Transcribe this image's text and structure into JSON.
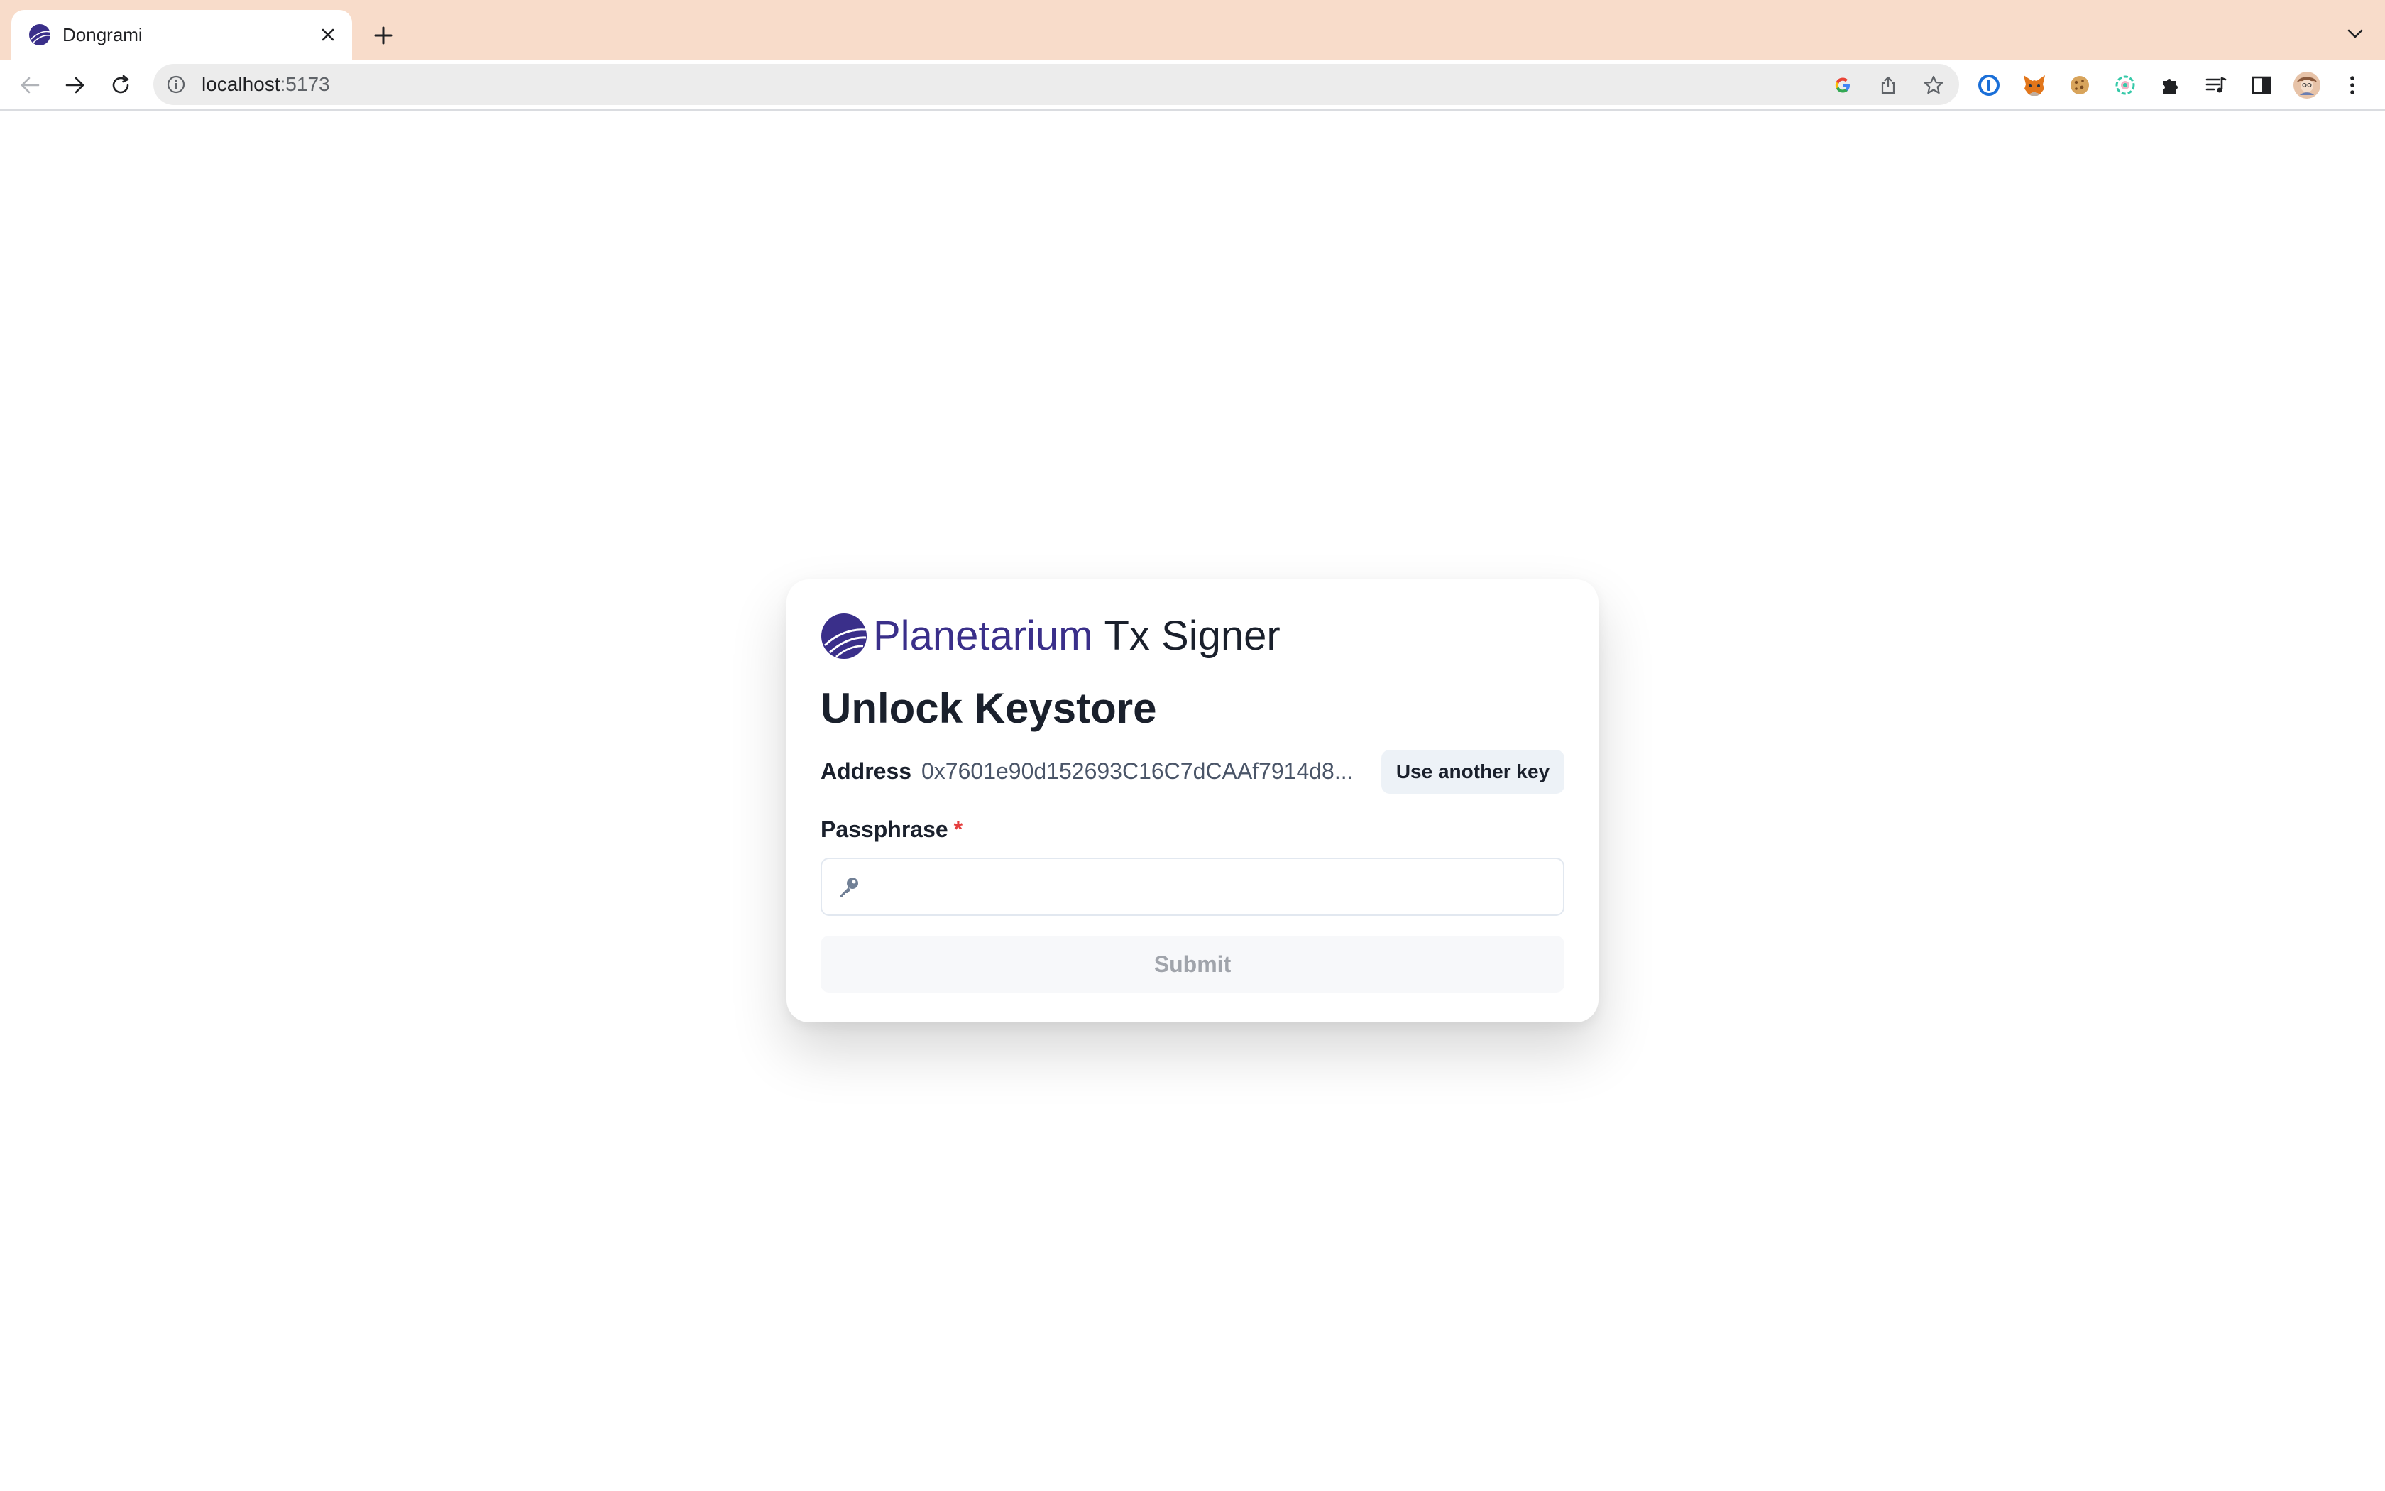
{
  "browser": {
    "tab": {
      "title": "Dongrami",
      "favicon": "planetarium-logo-icon"
    },
    "omnibox": {
      "host": "localhost",
      "port": ":5173"
    },
    "extensions": [
      "onepassword-icon",
      "metamask-fox-icon",
      "cookie-icon",
      "colorful-circle-icon",
      "puzzle-extensions-icon",
      "reading-list-icon",
      "side-panel-icon",
      "profile-avatar",
      "kebab-menu-icon"
    ]
  },
  "page": {
    "brand": {
      "name": "Planetarium",
      "suffix": "Tx Signer"
    },
    "heading": "Unlock Keystore",
    "address": {
      "label": "Address",
      "value": "0x7601e90d152693C16C7dCAAf7914d8..."
    },
    "another_key_label": "Use another key",
    "passphrase": {
      "label": "Passphrase",
      "required_mark": "*",
      "value": ""
    },
    "submit_label": "Submit"
  },
  "colors": {
    "brand": "#3a2f8a",
    "tabbar": "#f8dcca",
    "required": "#e53e3e"
  }
}
